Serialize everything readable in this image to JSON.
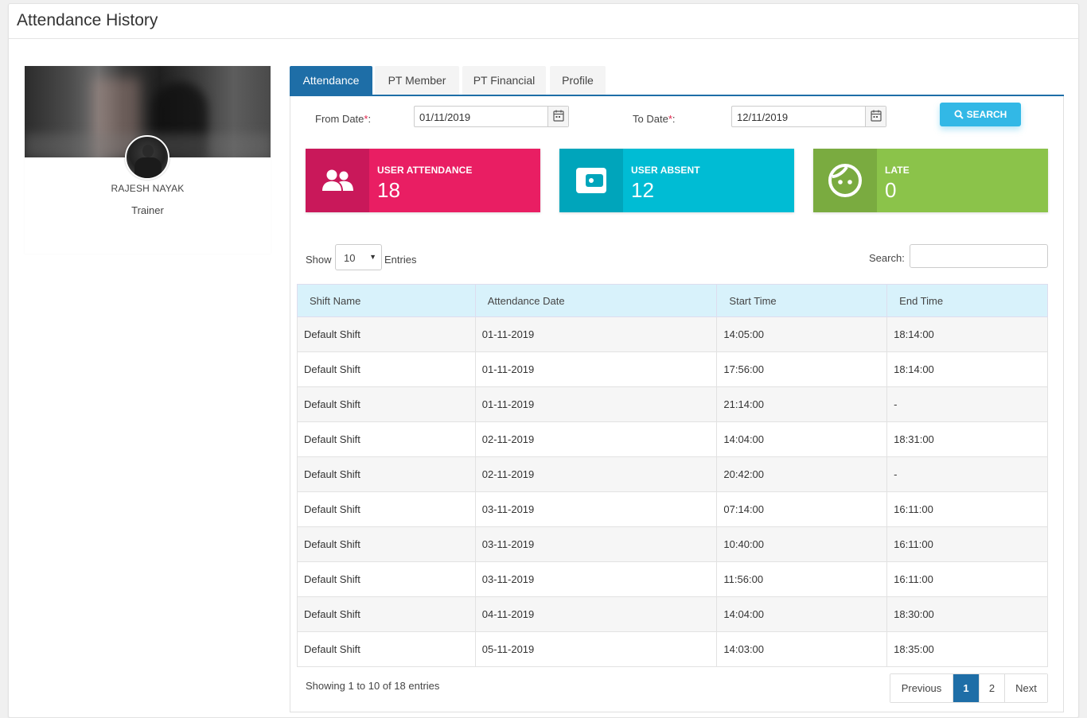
{
  "page": {
    "title": "Attendance History"
  },
  "profile": {
    "name": "RAJESH NAYAK",
    "role": "Trainer"
  },
  "tabs": [
    {
      "label": "Attendance",
      "active": true
    },
    {
      "label": "PT Member",
      "active": false
    },
    {
      "label": "PT Financial",
      "active": false
    },
    {
      "label": "Profile",
      "active": false
    }
  ],
  "filters": {
    "from_label": "From Date",
    "from_value": "01/11/2019",
    "to_label": "To Date",
    "to_value": "12/11/2019",
    "required_mark": "*",
    "colon": ":",
    "search_label": "SEARCH"
  },
  "stats": [
    {
      "title": "USER ATTENDANCE",
      "value": "18",
      "icon": "users-icon",
      "color": "#e91e63",
      "icon_bg": "#c9185a"
    },
    {
      "title": "USER ABSENT",
      "value": "12",
      "icon": "wallet-icon",
      "color": "#00bcd4",
      "icon_bg": "#00a5bb"
    },
    {
      "title": "LATE",
      "value": "0",
      "icon": "face-icon",
      "color": "#8bc34a",
      "icon_bg": "#7aab40"
    }
  ],
  "table_controls": {
    "show_label": "Show",
    "entries_label": "Entries",
    "length_value": "10",
    "search_label": "Search:"
  },
  "table": {
    "columns": [
      "Shift Name",
      "Attendance Date",
      "Start Time",
      "End Time"
    ],
    "rows": [
      [
        "Default Shift",
        "01-11-2019",
        "14:05:00",
        "18:14:00"
      ],
      [
        "Default Shift",
        "01-11-2019",
        "17:56:00",
        "18:14:00"
      ],
      [
        "Default Shift",
        "01-11-2019",
        "21:14:00",
        "-"
      ],
      [
        "Default Shift",
        "02-11-2019",
        "14:04:00",
        "18:31:00"
      ],
      [
        "Default Shift",
        "02-11-2019",
        "20:42:00",
        "-"
      ],
      [
        "Default Shift",
        "03-11-2019",
        "07:14:00",
        "16:11:00"
      ],
      [
        "Default Shift",
        "03-11-2019",
        "10:40:00",
        "16:11:00"
      ],
      [
        "Default Shift",
        "03-11-2019",
        "11:56:00",
        "16:11:00"
      ],
      [
        "Default Shift",
        "04-11-2019",
        "14:04:00",
        "18:30:00"
      ],
      [
        "Default Shift",
        "05-11-2019",
        "14:03:00",
        "18:35:00"
      ]
    ]
  },
  "footer": {
    "info": "Showing 1 to 10 of 18 entries",
    "pagination": {
      "previous": "Previous",
      "pages": [
        "1",
        "2"
      ],
      "current": "1",
      "next": "Next"
    }
  },
  "colors": {
    "primary": "#1e6ea7",
    "search_button": "#32b8e6",
    "table_header": "#d8f2fb"
  }
}
